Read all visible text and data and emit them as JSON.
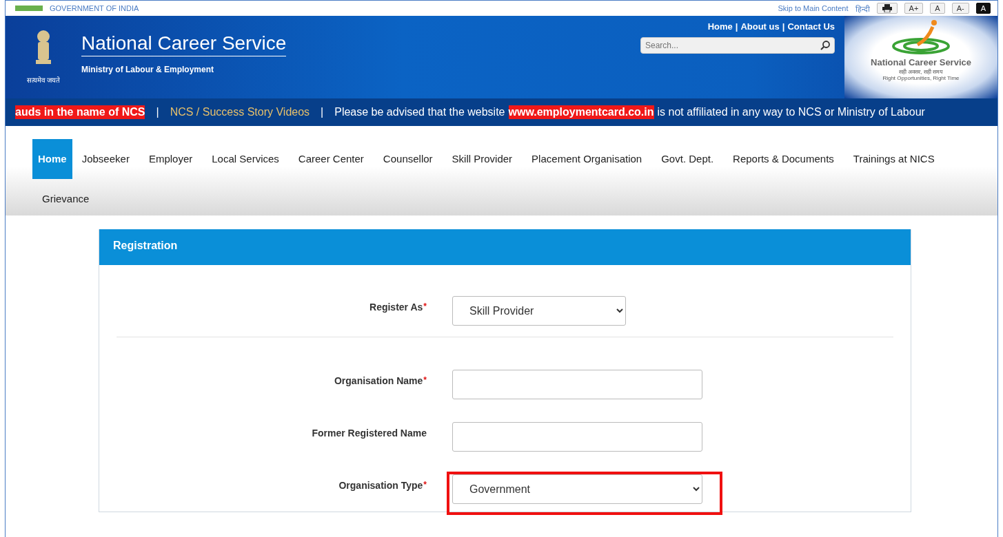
{
  "top_bar": {
    "government_label": "GOVERNMENT OF INDIA",
    "skip_link": "Skip to Main Content",
    "language_link": "हिन्दी",
    "text_tools": [
      "A+",
      "A",
      "A-",
      "A"
    ]
  },
  "header": {
    "emblem_caption": "सत्यमेव जयते",
    "title": "National Career Service",
    "subtitle": "Ministry of Labour & Employment",
    "links": [
      "Home",
      "About us",
      "Contact Us"
    ],
    "link_separator": "|",
    "search": {
      "placeholder": "Search..."
    },
    "logo": {
      "name": "National Career Service",
      "tagline_hi": "सही अवसर, सही समय",
      "tagline_en": "Right Opportunities, Right Time"
    }
  },
  "ticker": [
    {
      "kind": "highlight",
      "text": "auds in the name of NCS"
    },
    {
      "kind": "separator",
      "text": "|"
    },
    {
      "kind": "link",
      "text": "NCS / Success Story Videos"
    },
    {
      "kind": "separator",
      "text": "|"
    },
    {
      "kind": "plain",
      "text": "Please be advised that the website"
    },
    {
      "kind": "highlight",
      "text": "www.employmentcard.co.in"
    },
    {
      "kind": "plain",
      "text": "is not affiliated in any way to NCS or Ministry of Labour"
    }
  ],
  "nav": [
    {
      "label": "Home",
      "selected": true
    },
    {
      "label": "Jobseeker",
      "selected": false
    },
    {
      "label": "Employer",
      "selected": false
    },
    {
      "label": "Local Services",
      "selected": false
    },
    {
      "label": "Career Center",
      "selected": false
    },
    {
      "label": "Counsellor",
      "selected": false
    },
    {
      "label": "Skill Provider",
      "selected": false
    },
    {
      "label": "Placement Organisation",
      "selected": false
    },
    {
      "label": "Govt. Dept.",
      "selected": false
    },
    {
      "label": "Reports & Documents",
      "selected": false
    },
    {
      "label": "Trainings at NICS",
      "selected": false
    },
    {
      "label": "Grievance",
      "selected": false
    }
  ],
  "registration": {
    "title": "Registration",
    "required_mark": "*",
    "fields": [
      {
        "label": "Register As",
        "required": true,
        "kind": "select",
        "value": "Skill Provider",
        "divider_after": true,
        "highlighted": false
      },
      {
        "label": "Organisation Name",
        "required": true,
        "kind": "text",
        "divider_after": false,
        "highlighted": false
      },
      {
        "label": "Former Registered Name",
        "required": false,
        "kind": "text",
        "divider_after": false,
        "highlighted": false
      },
      {
        "label": "Organisation Type",
        "required": true,
        "kind": "select",
        "value": "Government",
        "divider_after": false,
        "highlighted": true
      }
    ]
  }
}
